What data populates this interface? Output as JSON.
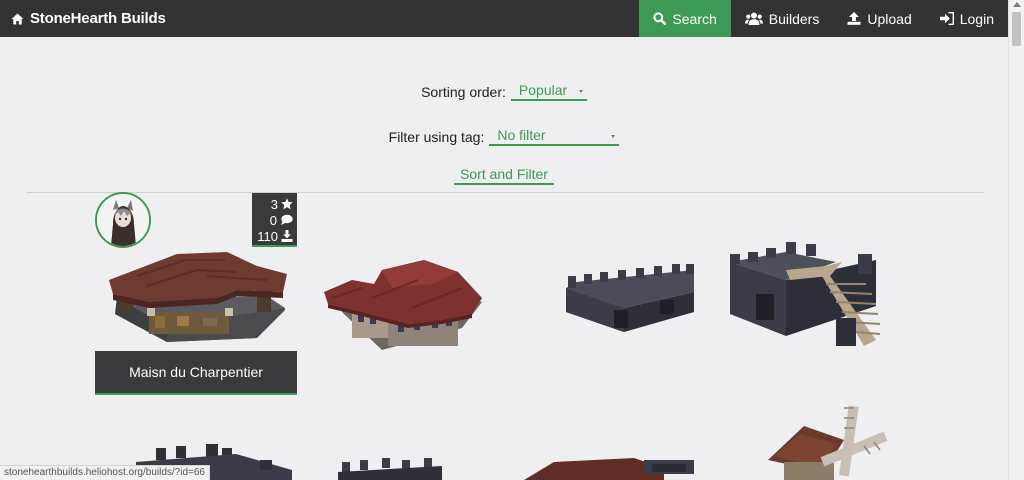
{
  "navbar": {
    "brand": "StoneHearth Builds",
    "items": [
      {
        "label": "Search",
        "icon": "search-icon",
        "active": true
      },
      {
        "label": "Builders",
        "icon": "users-icon"
      },
      {
        "label": "Upload",
        "icon": "upload-icon"
      },
      {
        "label": "Login",
        "icon": "login-icon"
      }
    ]
  },
  "filters": {
    "sort_label": "Sorting order:",
    "sort_value": "Popular",
    "tag_label": "Filter using tag:",
    "tag_value": "No filter",
    "submit_label": "Sort and Filter"
  },
  "builds": [
    {
      "title": "Maisn du Charpentier",
      "stars": "3",
      "comments": "0",
      "downloads": "110"
    }
  ],
  "status_url": "stonehearthbuilds.heliohost.org/builds/?id=66",
  "colors": {
    "accent": "#3c9a55",
    "navbar": "#333234",
    "card": "#3a393b",
    "background": "#efeef0"
  }
}
